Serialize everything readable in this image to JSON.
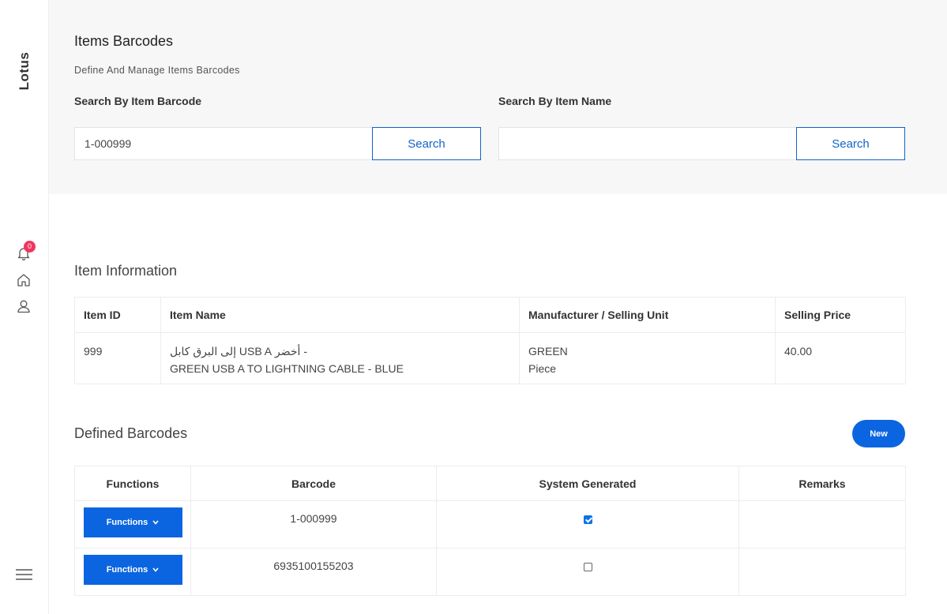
{
  "sidebar": {
    "brand": "Lotus",
    "notification_count": "0",
    "icons": [
      "bell-icon",
      "home-icon",
      "user-icon",
      "menu-icon"
    ]
  },
  "header": {
    "title": "Items Barcodes",
    "subtitle": "Define And Manage Items Barcodes",
    "barcode_search": {
      "label": "Search By Item Barcode",
      "value": "1-000999",
      "button": "Search"
    },
    "name_search": {
      "label": "Search By Item Name",
      "value": "",
      "button": "Search"
    }
  },
  "item_information": {
    "title": "Item Information",
    "columns": [
      "Item ID",
      "Item Name",
      "Manufacturer / Selling Unit",
      "Selling Price"
    ],
    "row": {
      "id": "999",
      "name_ar": "- أخضر USB A إلى البرق كابل",
      "name_en": "GREEN USB A TO LIGHTNING CABLE - BLUE",
      "manufacturer": "GREEN",
      "unit": "Piece",
      "price": "40.00"
    }
  },
  "defined_barcodes": {
    "title": "Defined Barcodes",
    "new_button": "New",
    "columns": [
      "Functions",
      "Barcode",
      "System Generated",
      "Remarks"
    ],
    "rows": [
      {
        "functions": "Functions",
        "barcode": "1-000999",
        "system_generated": true,
        "remarks": ""
      },
      {
        "functions": "Functions",
        "barcode": "6935100155203",
        "system_generated": false,
        "remarks": ""
      }
    ]
  },
  "colors": {
    "primary": "#0c65e0",
    "outline": "#1463c9",
    "badge": "#f0365e",
    "panel": "#f7f7f7"
  }
}
